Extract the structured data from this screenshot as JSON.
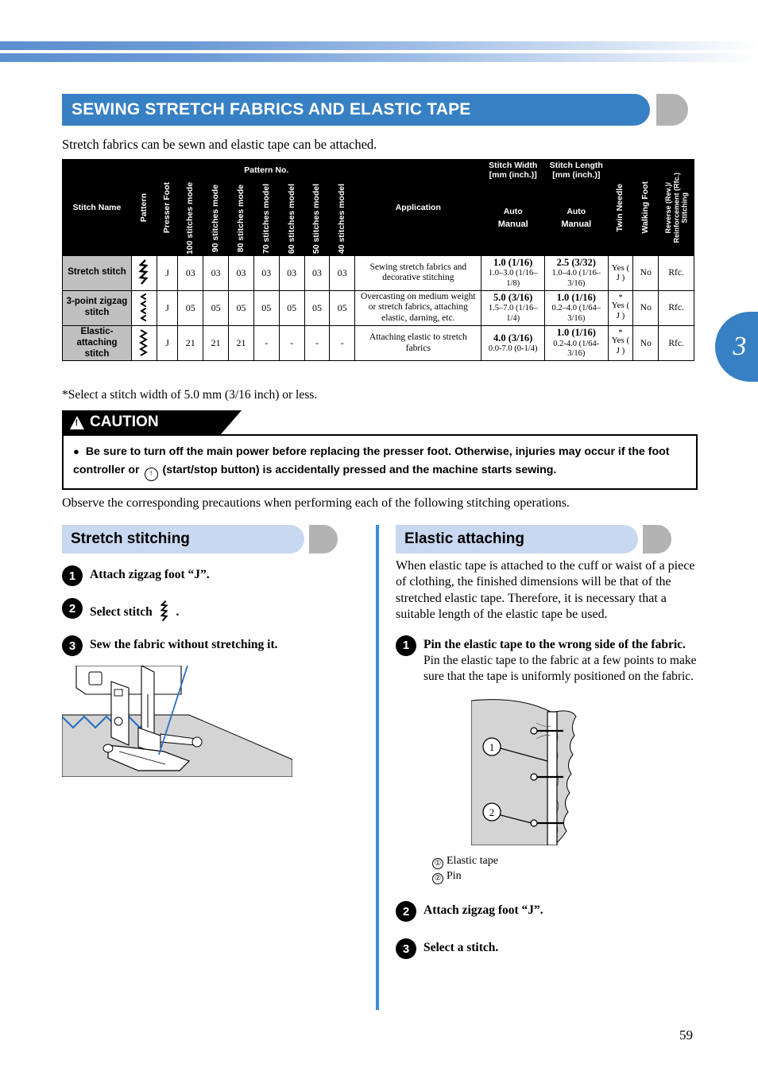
{
  "page": {
    "number": "59",
    "chapter_tab": "3"
  },
  "title": "SEWING STRETCH FABRICS AND ELASTIC TAPE",
  "intro": "Stretch fabrics can be sewn and elastic tape can be attached.",
  "table": {
    "headers": {
      "stitch_name": "Stitch Name",
      "pattern": "Pattern",
      "presser_foot": "Presser Foot",
      "pattern_no": "Pattern No.",
      "models": [
        "100 stitches mode",
        "90 stitches mode",
        "80 stitches mode",
        "70 stitches model",
        "60 stitches model",
        "50 stitches model",
        "40 stitches model"
      ],
      "application": "Application",
      "stitch_width": "Stitch Width [mm (inch.)]",
      "stitch_length": "Stitch Length [mm (inch.)]",
      "auto": "Auto",
      "manual": "Manual",
      "twin_needle": "Twin Needle",
      "walking_foot": "Walking Foot",
      "reverse": "Reverse (Rev.)/ Reinforcement (Rfc.) Stitching"
    },
    "rows": [
      {
        "name": "Stretch stitch",
        "pattern_icon": "stretch-stitch-glyph",
        "presser_foot": "J",
        "pattern_nos": [
          "03",
          "03",
          "03",
          "03",
          "03",
          "03",
          "03"
        ],
        "application": "Sewing stretch fabrics and decorative stitching",
        "width_auto": "1.0 (1/16)",
        "width_manual": "1.0–3.0 (1/16–1/8)",
        "length_auto": "2.5 (3/32)",
        "length_manual": "1.0–4.0 (1/16–3/16)",
        "twin_needle_star": "",
        "twin_needle": "Yes ( J )",
        "walking_foot": "No",
        "reverse": "Rfc."
      },
      {
        "name": "3-point zigzag stitch",
        "pattern_icon": "three-point-zigzag-glyph",
        "presser_foot": "J",
        "pattern_nos": [
          "05",
          "05",
          "05",
          "05",
          "05",
          "05",
          "05"
        ],
        "application": "Overcasting on medium weight or stretch fabrics, attaching elastic, darning, etc.",
        "width_auto": "5.0 (3/16)",
        "width_manual": "1.5–7.0 (1/16–1/4)",
        "length_auto": "1.0 (1/16)",
        "length_manual": "0.2–4.0 (1/64–3/16)",
        "twin_needle_star": "*",
        "twin_needle": "Yes ( J )",
        "walking_foot": "No",
        "reverse": "Rfc."
      },
      {
        "name": "Elastic-attaching stitch",
        "pattern_icon": "elastic-attaching-glyph",
        "presser_foot": "J",
        "pattern_nos": [
          "21",
          "21",
          "21",
          "-",
          "-",
          "-",
          "-"
        ],
        "application": "Attaching elastic to stretch fabrics",
        "width_auto": "4.0 (3/16)",
        "width_manual": "0.0-7.0 (0-1/4)",
        "length_auto": "1.0 (1/16)",
        "length_manual": "0.2-4.0 (1/64-3/16)",
        "twin_needle_star": "*",
        "twin_needle": "Yes ( J )",
        "walking_foot": "No",
        "reverse": "Rfc."
      }
    ]
  },
  "footnote": "*Select a stitch width of 5.0 mm (3/16 inch) or less.",
  "caution": {
    "label": "CAUTION",
    "bullet": "●",
    "text_part1": "Be sure to turn off the main power before replacing the presser foot. Otherwise, injuries may occur if the foot controller or",
    "icon_label": "↑",
    "text_part2": "(start/stop button) is accidentally pressed and the machine starts sewing."
  },
  "observe": "Observe the corresponding precautions when performing each of the following stitching operations.",
  "left_section": {
    "heading": "Stretch stitching",
    "steps": [
      {
        "num": "1",
        "text": "Attach zigzag foot “J”."
      },
      {
        "num": "2",
        "text": "Select stitch",
        "text_after": "."
      },
      {
        "num": "3",
        "text": "Sew the fabric without stretching it."
      }
    ]
  },
  "right_section": {
    "heading": "Elastic attaching",
    "intro": "When elastic tape is attached to the cuff or waist of a piece of clothing, the finished dimensions will be that of the stretched elastic tape. Therefore, it is necessary that a suitable length of the elastic tape be used.",
    "steps": [
      {
        "num": "1",
        "text": "Pin the elastic tape to the wrong side of the fabric.",
        "sub": "Pin the elastic tape to the fabric at a few points to make sure that the tape is uniformly positioned on the fabric."
      },
      {
        "num": "2",
        "text": "Attach zigzag foot “J”."
      },
      {
        "num": "3",
        "text": "Select a stitch."
      }
    ],
    "figure_captions": [
      {
        "num": "①",
        "label": "Elastic tape"
      },
      {
        "num": "②",
        "label": "Pin"
      }
    ]
  },
  "colors": {
    "brand_blue": "#3780c4",
    "section_bar": "#c8d8f0",
    "divider_blue": "#3a8ddb",
    "gray_dot": "#b3b3b3",
    "row_name_bg": "#c0c0c0"
  }
}
